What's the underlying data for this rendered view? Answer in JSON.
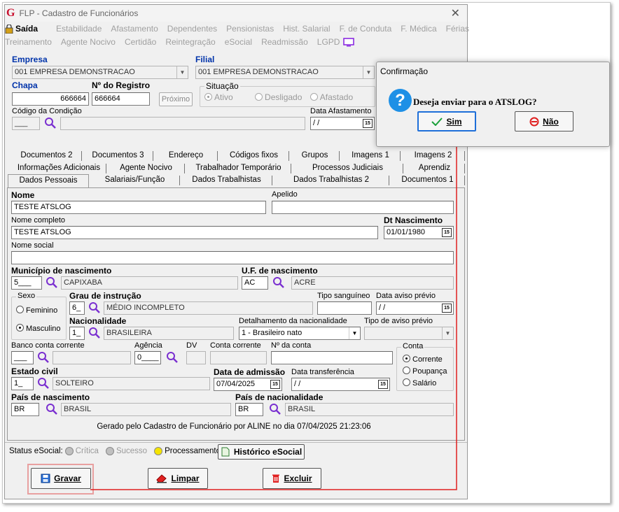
{
  "window": {
    "title": "FLP - Cadastro de Funcionários"
  },
  "menu": {
    "row1": [
      "Saída",
      "Estabilidade",
      "Afastamento",
      "Dependentes",
      "Pensionistas",
      "Hist. Salarial",
      "F. de Conduta",
      "F. Médica",
      "Férias"
    ],
    "row2": [
      "Treinamento",
      "Agente Nocivo",
      "Certidão",
      "Reintegração",
      "eSocial",
      "Readmissão",
      "LGPD"
    ]
  },
  "header": {
    "empresa_label": "Empresa",
    "empresa_value": "001 EMPRESA DEMONSTRACAO",
    "filial_label": "Filial",
    "filial_value": "001 EMPRESA DEMONSTRACAO",
    "chapa_label": "Chapa",
    "chapa_value": "666664",
    "registro_label": "Nº do Registro",
    "registro_value": "666664",
    "proximo_label": "Próximo",
    "situacao_label": "Situação",
    "situacao_options": [
      "Ativo",
      "Desligado",
      "Afastado"
    ],
    "condicao_label": "Código da Condição",
    "condicao_value": "___",
    "data_afastamento_label": "Data Afastamento",
    "data_afastamento_value": " / /"
  },
  "tabs": {
    "row1": [
      "Documentos 2",
      "Documentos 3",
      "Endereço",
      "Códigos fixos",
      "Grupos",
      "Imagens 1",
      "Imagens 2"
    ],
    "row2": [
      "Informações Adicionais",
      "Agente Nocivo",
      "Trabalhador Temporário",
      "Processos Judiciais",
      "Aprendiz"
    ],
    "row3": [
      "Dados Pessoais",
      "Salariais/Função",
      "Dados Trabalhistas",
      "Dados Trabalhistas 2",
      "Documentos 1"
    ]
  },
  "form": {
    "nome_label": "Nome",
    "nome_value": "TESTE ATSLOG",
    "apelido_label": "Apelido",
    "apelido_value": "",
    "nome_completo_label": "Nome completo",
    "nome_completo_value": "TESTE ATSLOG",
    "dt_nascimento_label": "Dt Nascimento",
    "dt_nascimento_value": "01/01/1980",
    "nome_social_label": "Nome social",
    "nome_social_value": "",
    "municipio_label": "Município de nascimento",
    "municipio_code": "5___",
    "municipio_name": "CAPIXABA",
    "uf_label": "U.F. de nascimento",
    "uf_code": "AC",
    "uf_name": "ACRE",
    "sexo_label": "Sexo",
    "sexo_options": [
      "Feminino",
      "Masculino"
    ],
    "grau_label": "Grau de instrução",
    "grau_code": "6_",
    "grau_name": "MÉDIO INCOMPLETO",
    "tipo_sanguineo_label": "Tipo sanguíneo",
    "tipo_sanguineo_value": "",
    "data_aviso_label": "Data aviso prévio",
    "data_aviso_value": " / /",
    "nacionalidade_label": "Nacionalidade",
    "nacionalidade_code": "1_",
    "nacionalidade_name": "BRASILEIRA",
    "detalhamento_label": "Detalhamento da nacionalidade",
    "detalhamento_value": "1 - Brasileiro nato",
    "tipo_aviso_label": "Tipo de aviso prévio",
    "tipo_aviso_value": "",
    "banco_label": "Banco conta corrente",
    "banco_code": "___",
    "agencia_label": "Agência",
    "agencia_value": "0____",
    "dv_label": "DV",
    "conta_corrente_label": "Conta corrente",
    "nro_conta_label": "Nº da conta",
    "conta_label": "Conta",
    "conta_options": [
      "Corrente",
      "Poupança",
      "Salário"
    ],
    "estado_civil_label": "Estado civil",
    "estado_civil_code": "1_",
    "estado_civil_name": "SOLTEIRO",
    "data_admissao_label": "Data de admissão",
    "data_admissao_value": "07/04/2025",
    "data_transferencia_label": "Data transferência",
    "data_transferencia_value": " / /",
    "pais_nasc_label": "País de nascimento",
    "pais_nasc_code": "BR",
    "pais_nasc_name": "BRASIL",
    "pais_nac_label": "País de nacionalidade",
    "pais_nac_code": "BR",
    "pais_nac_name": "BRASIL",
    "footer_text": "Gerado pelo Cadastro de Funcionário por ALINE no dia 07/04/2025 21:23:06"
  },
  "status": {
    "label": "Status eSocial:",
    "critica": "Crítica",
    "sucesso": "Sucesso",
    "processamento": "Processamento",
    "historico": "Histórico eSocial"
  },
  "actions": {
    "gravar": "Gravar",
    "limpar": "Limpar",
    "excluir": "Excluir"
  },
  "dialog": {
    "title": "Confirmação",
    "message": "Deseja enviar para o ATSLOG?",
    "sim": "Sim",
    "nao": "Não"
  },
  "colors": {
    "accent_red": "#e02020",
    "label_blue": "#0033aa",
    "highlight_box": "#e8a0a0",
    "search_purple": "#7a2fd0"
  }
}
